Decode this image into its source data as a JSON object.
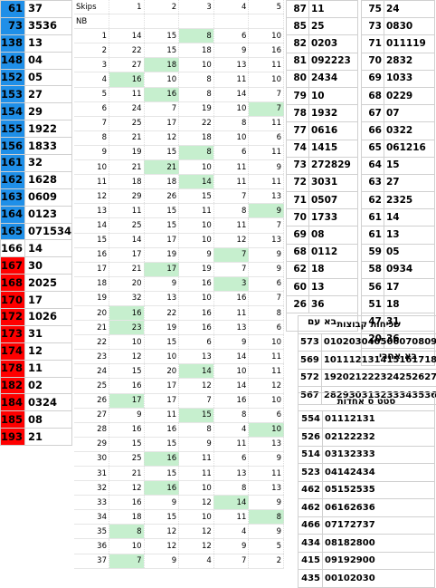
{
  "left_list": [
    {
      "num": "61",
      "val": "37",
      "color": "blue"
    },
    {
      "num": "73",
      "val": "3536",
      "color": "blue"
    },
    {
      "num": "138",
      "val": "13",
      "color": "blue"
    },
    {
      "num": "148",
      "val": "04",
      "color": "blue"
    },
    {
      "num": "152",
      "val": "05",
      "color": "blue"
    },
    {
      "num": "153",
      "val": "27",
      "color": "blue"
    },
    {
      "num": "154",
      "val": "29",
      "color": "blue"
    },
    {
      "num": "155",
      "val": "1922",
      "color": "blue"
    },
    {
      "num": "156",
      "val": "1833",
      "color": "blue"
    },
    {
      "num": "161",
      "val": "32",
      "color": "blue"
    },
    {
      "num": "162",
      "val": "1628",
      "color": "blue"
    },
    {
      "num": "163",
      "val": "0609",
      "color": "blue"
    },
    {
      "num": "164",
      "val": "0123",
      "color": "blue"
    },
    {
      "num": "165",
      "val": "071534",
      "color": "blue"
    },
    {
      "num": "166",
      "val": "14",
      "color": "white"
    },
    {
      "num": "167",
      "val": "30",
      "color": "red"
    },
    {
      "num": "168",
      "val": "2025",
      "color": "red"
    },
    {
      "num": "170",
      "val": "17",
      "color": "red"
    },
    {
      "num": "172",
      "val": "1026",
      "color": "red"
    },
    {
      "num": "173",
      "val": "31",
      "color": "red"
    },
    {
      "num": "174",
      "val": "12",
      "color": "red"
    },
    {
      "num": "178",
      "val": "11",
      "color": "red"
    },
    {
      "num": "182",
      "val": "02",
      "color": "red"
    },
    {
      "num": "184",
      "val": "0324",
      "color": "red"
    },
    {
      "num": "185",
      "val": "08",
      "color": "red"
    },
    {
      "num": "193",
      "val": "21",
      "color": "red"
    }
  ],
  "grid": {
    "header_label": "Skips",
    "columns": [
      "1",
      "2",
      "3",
      "4",
      "5"
    ],
    "sub_label": "NB",
    "rows": [
      {
        "n": "1",
        "c": [
          "14",
          "15",
          "8",
          "6",
          "10"
        ],
        "h": [
          2
        ]
      },
      {
        "n": "2",
        "c": [
          "22",
          "15",
          "18",
          "9",
          "16"
        ],
        "h": []
      },
      {
        "n": "3",
        "c": [
          "27",
          "18",
          "10",
          "13",
          "11"
        ],
        "h": [
          1
        ]
      },
      {
        "n": "4",
        "c": [
          "16",
          "10",
          "8",
          "11",
          "10"
        ],
        "h": [
          0
        ]
      },
      {
        "n": "5",
        "c": [
          "11",
          "16",
          "8",
          "14",
          "7"
        ],
        "h": [
          1
        ]
      },
      {
        "n": "6",
        "c": [
          "24",
          "7",
          "19",
          "10",
          "7"
        ],
        "h": [
          4
        ]
      },
      {
        "n": "7",
        "c": [
          "25",
          "17",
          "22",
          "8",
          "11"
        ],
        "h": []
      },
      {
        "n": "8",
        "c": [
          "21",
          "12",
          "18",
          "10",
          "6"
        ],
        "h": []
      },
      {
        "n": "9",
        "c": [
          "19",
          "15",
          "8",
          "6",
          "11"
        ],
        "h": [
          2
        ]
      },
      {
        "n": "10",
        "c": [
          "21",
          "21",
          "10",
          "11",
          "9"
        ],
        "h": [
          1
        ]
      },
      {
        "n": "11",
        "c": [
          "18",
          "18",
          "14",
          "11",
          "11"
        ],
        "h": [
          2
        ]
      },
      {
        "n": "12",
        "c": [
          "29",
          "26",
          "15",
          "7",
          "13"
        ],
        "h": []
      },
      {
        "n": "13",
        "c": [
          "11",
          "15",
          "11",
          "8",
          "9"
        ],
        "h": [
          4
        ]
      },
      {
        "n": "14",
        "c": [
          "25",
          "15",
          "10",
          "11",
          "7"
        ],
        "h": []
      },
      {
        "n": "15",
        "c": [
          "14",
          "17",
          "10",
          "12",
          "13"
        ],
        "h": []
      },
      {
        "n": "16",
        "c": [
          "17",
          "19",
          "9",
          "7",
          "9"
        ],
        "h": [
          3
        ]
      },
      {
        "n": "17",
        "c": [
          "21",
          "17",
          "19",
          "7",
          "9"
        ],
        "h": [
          1
        ]
      },
      {
        "n": "18",
        "c": [
          "20",
          "9",
          "16",
          "3",
          "6"
        ],
        "h": [
          3
        ]
      },
      {
        "n": "19",
        "c": [
          "32",
          "13",
          "10",
          "16",
          "7"
        ],
        "h": []
      },
      {
        "n": "20",
        "c": [
          "16",
          "22",
          "16",
          "11",
          "8"
        ],
        "h": [
          0
        ]
      },
      {
        "n": "21",
        "c": [
          "23",
          "19",
          "16",
          "13",
          "6"
        ],
        "h": [
          0
        ]
      },
      {
        "n": "22",
        "c": [
          "10",
          "15",
          "6",
          "9",
          "10"
        ],
        "h": []
      },
      {
        "n": "23",
        "c": [
          "12",
          "10",
          "13",
          "14",
          "11"
        ],
        "h": []
      },
      {
        "n": "24",
        "c": [
          "15",
          "20",
          "14",
          "10",
          "11"
        ],
        "h": [
          2
        ]
      },
      {
        "n": "25",
        "c": [
          "16",
          "17",
          "12",
          "14",
          "12"
        ],
        "h": []
      },
      {
        "n": "26",
        "c": [
          "17",
          "17",
          "7",
          "16",
          "10"
        ],
        "h": [
          0
        ]
      },
      {
        "n": "27",
        "c": [
          "9",
          "11",
          "15",
          "8",
          "6"
        ],
        "h": [
          2
        ]
      },
      {
        "n": "28",
        "c": [
          "16",
          "16",
          "8",
          "4",
          "10"
        ],
        "h": [
          4
        ]
      },
      {
        "n": "29",
        "c": [
          "15",
          "15",
          "9",
          "11",
          "13"
        ],
        "h": []
      },
      {
        "n": "30",
        "c": [
          "25",
          "16",
          "11",
          "6",
          "9"
        ],
        "h": [
          1
        ]
      },
      {
        "n": "31",
        "c": [
          "21",
          "15",
          "11",
          "13",
          "11"
        ],
        "h": []
      },
      {
        "n": "32",
        "c": [
          "12",
          "16",
          "10",
          "8",
          "13"
        ],
        "h": [
          1
        ]
      },
      {
        "n": "33",
        "c": [
          "16",
          "9",
          "12",
          "14",
          "9"
        ],
        "h": [
          3
        ]
      },
      {
        "n": "34",
        "c": [
          "18",
          "15",
          "10",
          "11",
          "8"
        ],
        "h": [
          4
        ]
      },
      {
        "n": "35",
        "c": [
          "8",
          "12",
          "12",
          "4",
          "9"
        ],
        "h": [
          0
        ]
      },
      {
        "n": "36",
        "c": [
          "10",
          "12",
          "12",
          "9",
          "5"
        ],
        "h": []
      },
      {
        "n": "37",
        "c": [
          "7",
          "9",
          "4",
          "7",
          "2"
        ],
        "h": [
          0
        ]
      }
    ]
  },
  "mid_list": [
    {
      "k": "87",
      "v": "11"
    },
    {
      "k": "85",
      "v": "25"
    },
    {
      "k": "82",
      "v": "0203"
    },
    {
      "k": "81",
      "v": "092223"
    },
    {
      "k": "80",
      "v": "2434"
    },
    {
      "k": "79",
      "v": "10"
    },
    {
      "k": "78",
      "v": "1932"
    },
    {
      "k": "77",
      "v": "0616"
    },
    {
      "k": "74",
      "v": "1415"
    },
    {
      "k": "73",
      "v": "272829"
    },
    {
      "k": "72",
      "v": "3031"
    },
    {
      "k": "71",
      "v": "0507"
    },
    {
      "k": "70",
      "v": "1733"
    },
    {
      "k": "69",
      "v": "08"
    },
    {
      "k": "68",
      "v": "0112"
    },
    {
      "k": "62",
      "v": "18"
    },
    {
      "k": "60",
      "v": "13"
    },
    {
      "k": "26",
      "v": "36"
    }
  ],
  "mid_footer": "בא עם",
  "right_list": [
    {
      "k": "75",
      "v": "24"
    },
    {
      "k": "73",
      "v": "0830"
    },
    {
      "k": "71",
      "v": "011119"
    },
    {
      "k": "70",
      "v": "2832"
    },
    {
      "k": "69",
      "v": "1033"
    },
    {
      "k": "68",
      "v": "0229"
    },
    {
      "k": "67",
      "v": "07"
    },
    {
      "k": "66",
      "v": "0322"
    },
    {
      "k": "65",
      "v": "061216"
    },
    {
      "k": "64",
      "v": "15"
    },
    {
      "k": "63",
      "v": "27"
    },
    {
      "k": "62",
      "v": "2325"
    },
    {
      "k": "61",
      "v": "14"
    },
    {
      "k": "61",
      "v": "13"
    },
    {
      "k": "59",
      "v": "05"
    },
    {
      "k": "58",
      "v": "0934"
    },
    {
      "k": "56",
      "v": "17"
    },
    {
      "k": "51",
      "v": "18"
    },
    {
      "k": "47",
      "v": "31"
    },
    {
      "k": "20",
      "v": "36"
    }
  ],
  "right_footer": "בא אחרי",
  "groups": {
    "title": "שכיחות קבוצות",
    "rows": [
      {
        "k": "573",
        "v": "010203040506070809"
      },
      {
        "k": "569",
        "v": "101112131415161718"
      },
      {
        "k": "572",
        "v": "192021222324252627"
      },
      {
        "k": "567",
        "v": "282930313233343536"
      }
    ]
  },
  "sets": {
    "title": "סטט ס אחדות",
    "rows": [
      {
        "k": "554",
        "v": "01112131"
      },
      {
        "k": "526",
        "v": "02122232"
      },
      {
        "k": "514",
        "v": "03132333"
      },
      {
        "k": "523",
        "v": "04142434"
      },
      {
        "k": "462",
        "v": "05152535"
      },
      {
        "k": "462",
        "v": "06162636"
      },
      {
        "k": "466",
        "v": "07172737"
      },
      {
        "k": "434",
        "v": "08182800"
      },
      {
        "k": "415",
        "v": "09192900"
      },
      {
        "k": "435",
        "v": "00102030"
      }
    ]
  },
  "colors": {
    "blue": "#1f8fe8",
    "red": "#ff0000",
    "highlight": "#c6efce"
  }
}
